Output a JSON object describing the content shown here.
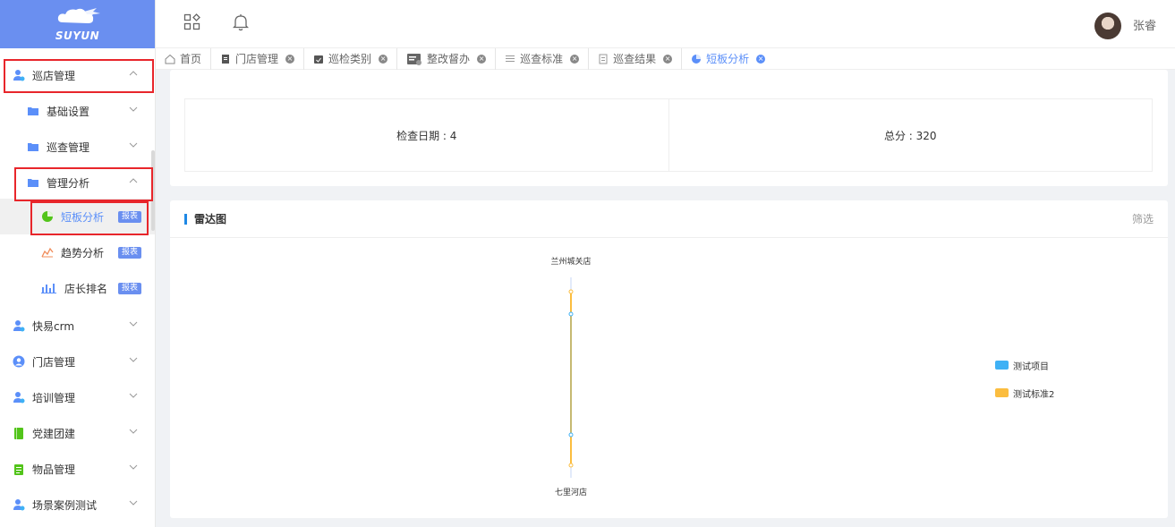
{
  "logo": {
    "brand": "SUYUN"
  },
  "sidebar": {
    "items": [
      {
        "label": "巡店管理",
        "icon": "user-check-icon"
      },
      {
        "label": "基础设置",
        "icon": "folder-icon"
      },
      {
        "label": "巡查管理",
        "icon": "folder-icon"
      },
      {
        "label": "管理分析",
        "icon": "folder-icon"
      },
      {
        "label": "短板分析",
        "icon": "pie-chart-icon",
        "badge": "报表"
      },
      {
        "label": "趋势分析",
        "icon": "line-chart-icon",
        "badge": "报表"
      },
      {
        "label": "店长排名",
        "icon": "bar-chart-icon",
        "badge": "报表"
      },
      {
        "label": "快易crm",
        "icon": "user-check-icon"
      },
      {
        "label": "门店管理",
        "icon": "user-circle-icon"
      },
      {
        "label": "培训管理",
        "icon": "user-check-icon"
      },
      {
        "label": "党建团建",
        "icon": "book-icon"
      },
      {
        "label": "物品管理",
        "icon": "clipboard-icon"
      },
      {
        "label": "场景案例测试",
        "icon": "user-check-icon"
      }
    ]
  },
  "header": {
    "username": "张睿"
  },
  "tabs": [
    {
      "label": "首页",
      "icon": "home-icon",
      "closable": false
    },
    {
      "label": "门店管理",
      "icon": "doc-icon",
      "closable": true
    },
    {
      "label": "巡检类别",
      "icon": "calendar-icon",
      "closable": true
    },
    {
      "label": "整改督办",
      "icon": "task-icon",
      "closable": true
    },
    {
      "label": "巡查标准",
      "icon": "list-icon",
      "closable": true
    },
    {
      "label": "巡查结果",
      "icon": "report-icon",
      "closable": true
    },
    {
      "label": "短板分析",
      "icon": "pie-chart-icon",
      "closable": true,
      "active": true
    }
  ],
  "info": {
    "check_date": "检查日期 : 4",
    "total_score": "总分 : 320"
  },
  "radar": {
    "title": "雷达图",
    "filter_label": "筛选"
  },
  "colors": {
    "accent": "#5b8ff9",
    "logo_bg": "#6a8ff0",
    "series1": "#3fb1f5",
    "series2": "#fbbd3f",
    "red_highlight": "#e8262b"
  },
  "chart_data": {
    "type": "radar",
    "indicators": [
      "兰州城关店",
      "七里河店"
    ],
    "series": [
      {
        "name": "测试项目",
        "color": "#3fb1f5"
      },
      {
        "name": "测试标准2",
        "color": "#fbbd3f"
      }
    ],
    "legend_position": "right"
  }
}
